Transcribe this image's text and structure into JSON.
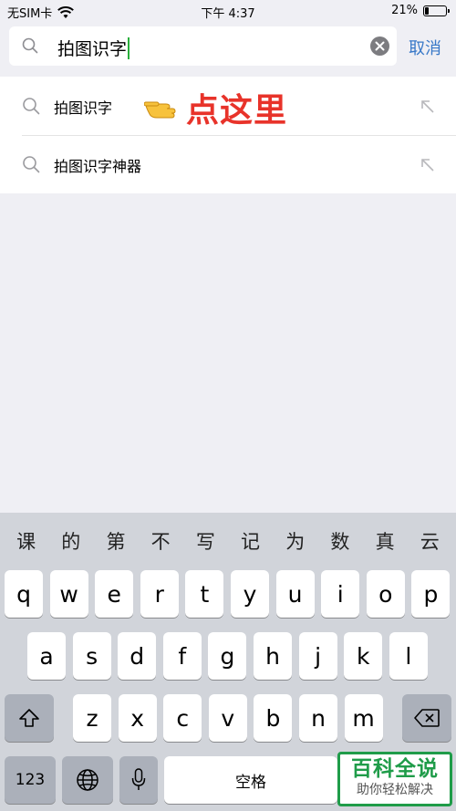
{
  "status_bar": {
    "carrier": "无SIM卡",
    "time": "下午 4:37",
    "battery_percent": "21%",
    "battery_level": 0.21
  },
  "search": {
    "query": "拍图识字",
    "cancel_label": "取消"
  },
  "suggestions": [
    {
      "label": "拍图识字"
    },
    {
      "label": "拍图识字神器"
    }
  ],
  "annotation": {
    "text": "点这里",
    "pointer_icon": "pointing-hand-icon",
    "color": "#e8332a"
  },
  "keyboard": {
    "candidates": [
      "课",
      "的",
      "第",
      "不",
      "写",
      "记",
      "为",
      "数",
      "真",
      "云"
    ],
    "row1": [
      "q",
      "w",
      "e",
      "r",
      "t",
      "y",
      "u",
      "i",
      "o",
      "p"
    ],
    "row2": [
      "a",
      "s",
      "d",
      "f",
      "g",
      "h",
      "j",
      "k",
      "l"
    ],
    "row3": [
      "z",
      "x",
      "c",
      "v",
      "b",
      "n",
      "m"
    ],
    "numbers_label": "123",
    "space_label": "空格"
  },
  "watermark": {
    "title": "百科全说",
    "subtitle": "助你轻松解决"
  },
  "colors": {
    "accent": "#3878c8",
    "cursor": "#2aaf3c",
    "watermark_green": "#1f9c49"
  }
}
